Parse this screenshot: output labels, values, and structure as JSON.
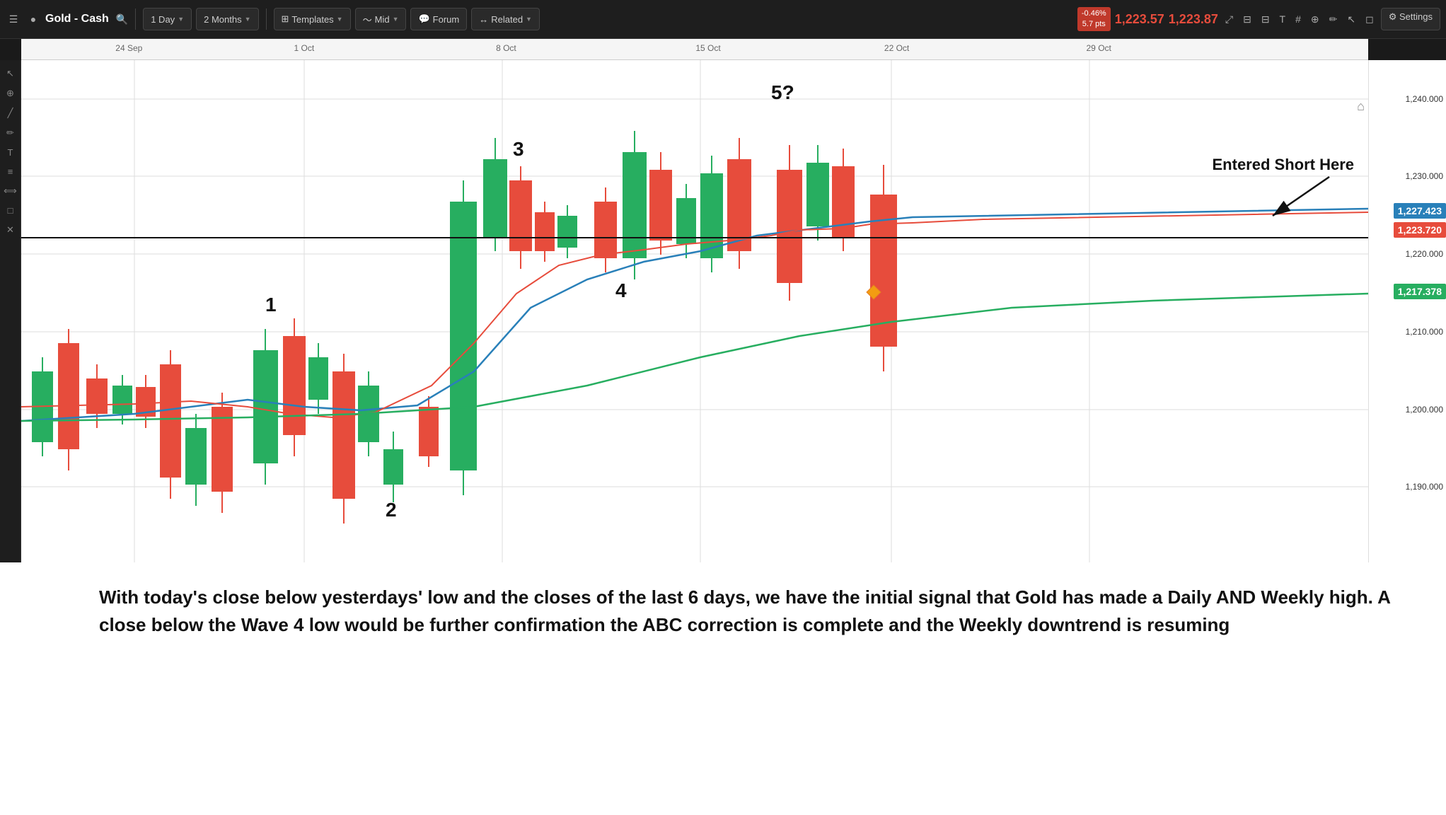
{
  "topbar": {
    "logo_icon": "chart-icon",
    "title": "Gold - Cash",
    "search_icon": "search-icon",
    "timeframe": "1 Day",
    "period": "2 Months",
    "templates_label": "Templates",
    "mid_label": "Mid",
    "forum_label": "Forum",
    "related_label": "Related",
    "price_change_pct": "-0.46%",
    "price_change_pts": "5.7 pts",
    "price_ask": "1,223.57",
    "price_bid": "1,223.87",
    "settings_label": "Settings"
  },
  "chart": {
    "title": "Gold - Cash",
    "price_levels": [
      {
        "label": "1,240.000",
        "value": 1240
      },
      {
        "label": "1,230.000",
        "value": 1230
      },
      {
        "label": "1,220.000",
        "value": 1220
      },
      {
        "label": "1,210.000",
        "value": 1210
      },
      {
        "label": "1,200.000",
        "value": 1200
      },
      {
        "label": "1,190.000",
        "value": 1190
      }
    ],
    "price_blue": "1,227.423",
    "price_red": "1,223.720",
    "price_green": "1,217.378",
    "time_labels": [
      "24 Sep",
      "1 Oct",
      "8 Oct",
      "15 Oct",
      "22 Oct",
      "29 Oct"
    ],
    "annotations": {
      "label1": "1",
      "label2": "2",
      "label3": "3",
      "label4": "4",
      "label5": "5?",
      "entered_short": "Entered Short Here"
    }
  },
  "analysis_text": "With today's close below yesterdays' low and the closes of the last 6 days, we have the initial signal that Gold has made a Daily AND Weekly high. A close below the Wave 4 low would be further confirmation the ABC correction is complete and the Weekly downtrend is resuming"
}
